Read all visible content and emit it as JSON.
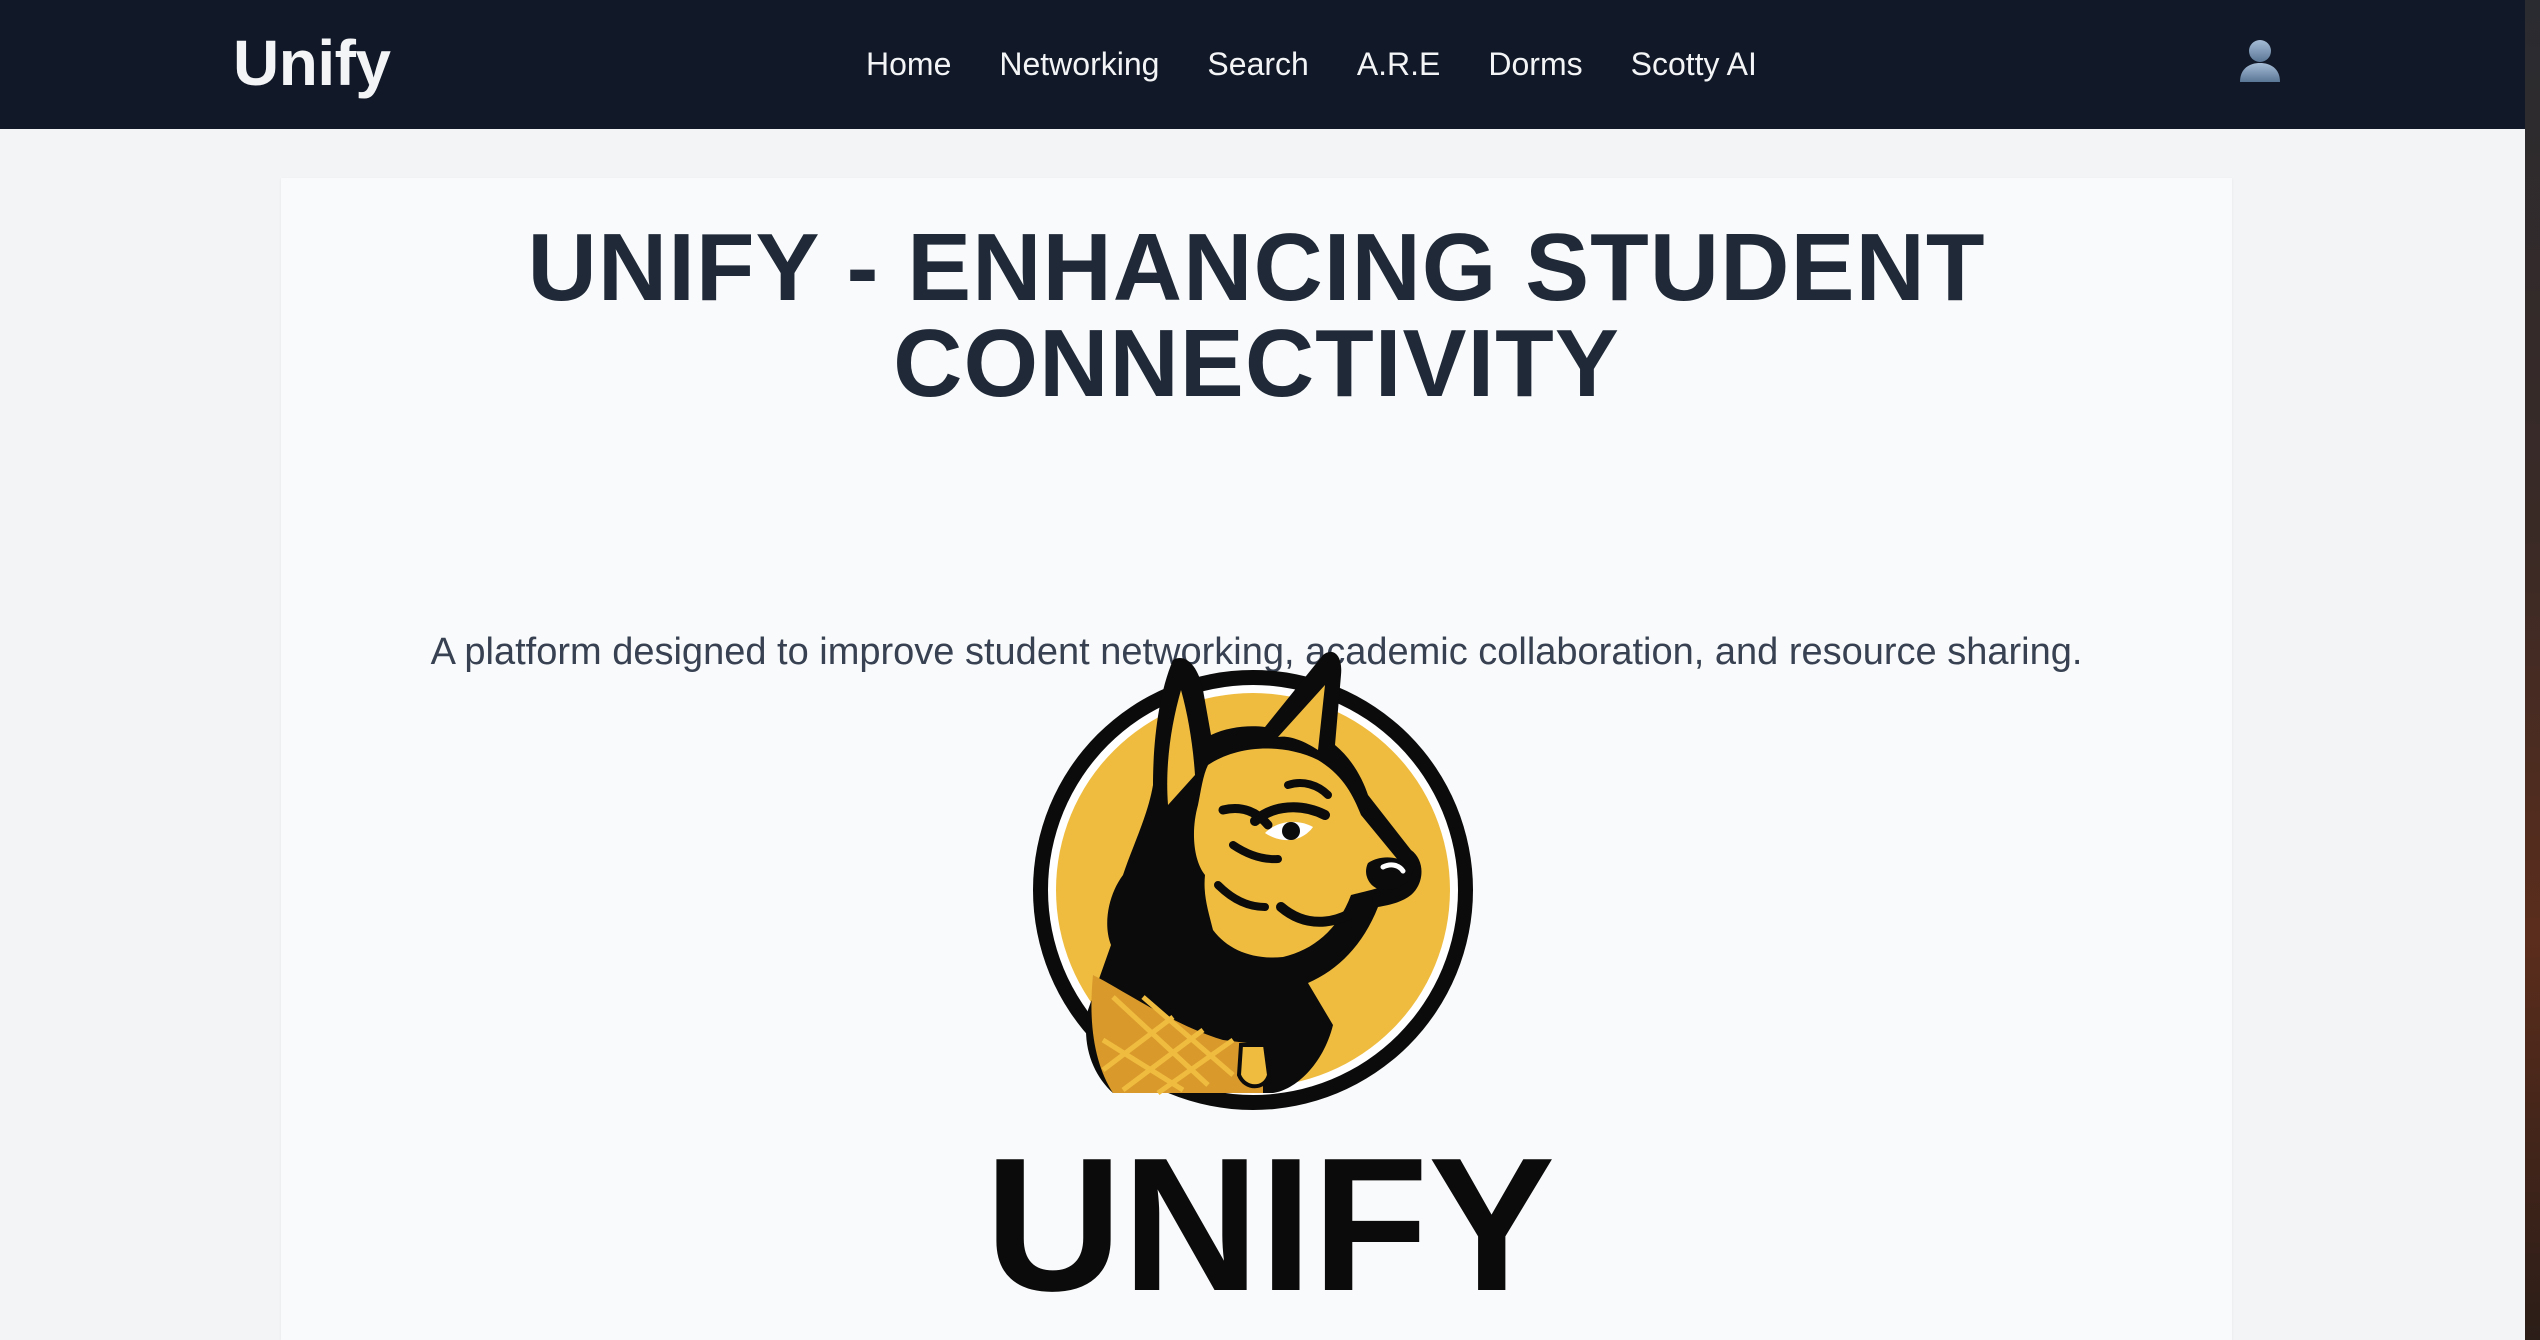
{
  "navbar": {
    "brand": "Unify",
    "links": [
      {
        "label": "Home"
      },
      {
        "label": "Networking"
      },
      {
        "label": "Search"
      },
      {
        "label": "A.R.E"
      },
      {
        "label": "Dorms"
      },
      {
        "label": "Scotty AI"
      }
    ],
    "user_icon": "user-icon"
  },
  "hero": {
    "title_line1": "UNIFY - ENHANCING STUDENT",
    "title_line2": "CONNECTIVITY",
    "subtitle": "A platform designed to improve student networking, academic collaboration, and resource sharing.",
    "logo": {
      "icon": "dog-mascot-logo",
      "wordmark": "UNIFY",
      "colors": {
        "gold": "#efbc40",
        "black": "#0b0b0b"
      }
    }
  },
  "colors": {
    "nav_bg": "#111827",
    "page_bg": "#f3f4f6",
    "card_bg": "#f9fafb",
    "title": "#1f2937",
    "subtitle": "#374151"
  }
}
